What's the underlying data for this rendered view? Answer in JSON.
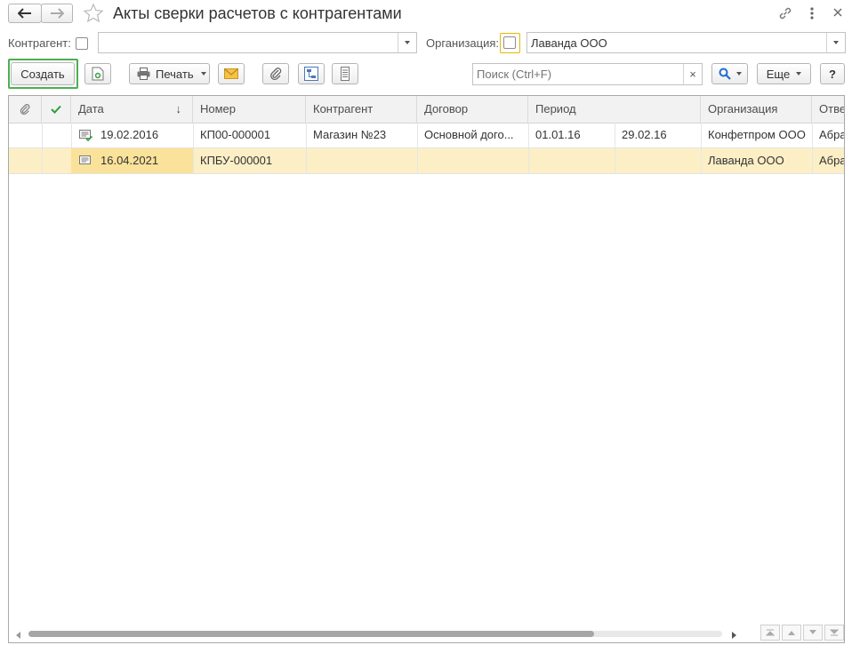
{
  "window": {
    "title": "Акты сверки расчетов с контрагентами"
  },
  "filters": {
    "counterparty_label": "Контрагент:",
    "counterparty_value": "",
    "organization_label": "Организация:",
    "organization_value": "Лаванда ООО"
  },
  "toolbar": {
    "create_label": "Создать",
    "print_label": "Печать",
    "search_placeholder": "Поиск (Ctrl+F)",
    "more_label": "Еще",
    "help_label": "?",
    "clear_label": "×"
  },
  "table": {
    "columns": [
      "Дата",
      "Номер",
      "Контрагент",
      "Договор",
      "Период",
      "Организация",
      "Ответ"
    ],
    "sort_indicator": "↓",
    "rows": [
      {
        "date": "19.02.2016",
        "number": "КП00-000001",
        "counterparty": "Магазин №23",
        "contract": "Основной дого...",
        "period_start": "01.01.16",
        "period_end": "29.02.16",
        "organization": "Конфетпром ООО",
        "responsible": "Абра"
      },
      {
        "date": "16.04.2021",
        "number": "КПБУ-000001",
        "counterparty": "",
        "contract": "",
        "period_start": "",
        "period_end": "",
        "organization": "Лаванда ООО",
        "responsible": "Абра"
      }
    ]
  },
  "colors": {
    "create_border": "#4caf50",
    "selected_row": "#fcefc6",
    "selected_cell": "#fbe29a",
    "org_checkbox_border": "#e6b800",
    "check_green": "#2e9e3a"
  }
}
